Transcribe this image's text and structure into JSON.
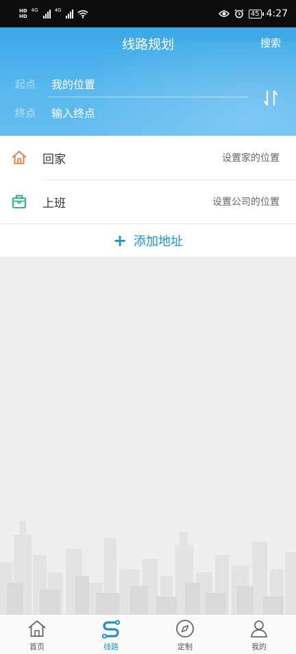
{
  "status_bar": {
    "hd1": "HD",
    "hd2": "HD",
    "net1": "4G",
    "net2": "4G",
    "battery": "45",
    "time": "4:27"
  },
  "header": {
    "title": "线路规划",
    "search_label": "搜索",
    "start_label": "起点",
    "start_value": "我的位置",
    "end_label": "终点",
    "end_placeholder": "输入终点"
  },
  "shortcuts": [
    {
      "name": "回家",
      "hint": "设置家的位置",
      "icon": "home-icon"
    },
    {
      "name": "上班",
      "hint": "设置公司的位置",
      "icon": "briefcase-icon"
    }
  ],
  "add_address_label": "添加地址",
  "bottom_nav": [
    {
      "label": "首页",
      "icon": "home-icon",
      "active": false
    },
    {
      "label": "线路",
      "icon": "route-icon",
      "active": true
    },
    {
      "label": "定制",
      "icon": "compass-icon",
      "active": false
    },
    {
      "label": "我的",
      "icon": "user-icon",
      "active": false
    }
  ],
  "colors": {
    "accent": "#1f8fd2",
    "header_top": "#3aa8e6",
    "header_bottom": "#65bdf0",
    "home_icon": "#e2814a",
    "work_icon": "#2bb38f"
  }
}
